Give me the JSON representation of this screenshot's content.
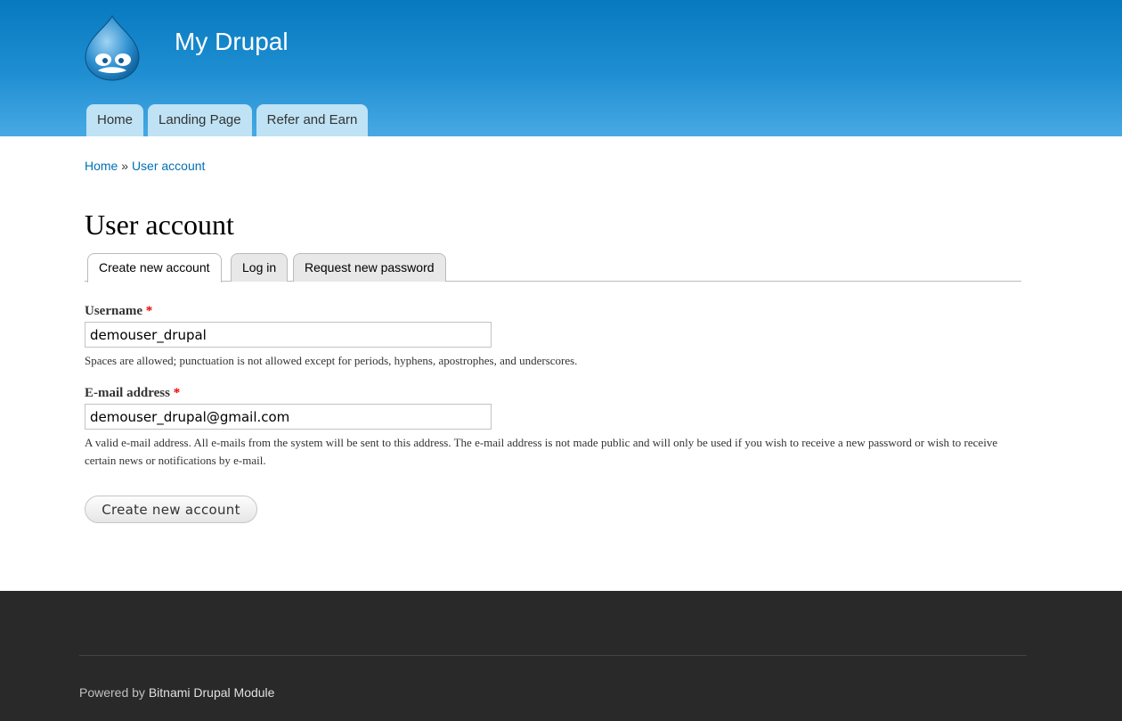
{
  "site": {
    "name": "My Drupal"
  },
  "main_menu": [
    "Home",
    "Landing Page",
    "Refer and Earn"
  ],
  "breadcrumb": {
    "home": "Home",
    "separator": "»",
    "current": "User account"
  },
  "page_title": "User account",
  "tabs": {
    "create": "Create new account",
    "login": "Log in",
    "request": "Request new password"
  },
  "form": {
    "username": {
      "label": "Username",
      "required_mark": "*",
      "value": "demouser_drupal",
      "description": "Spaces are allowed; punctuation is not allowed except for periods, hyphens, apostrophes, and underscores."
    },
    "email": {
      "label": "E-mail address",
      "required_mark": "*",
      "value": "demouser_drupal@gmail.com",
      "description": "A valid e-mail address. All e-mails from the system will be sent to this address. The e-mail address is not made public and will only be used if you wish to receive a new password or wish to receive certain news or notifications by e-mail."
    },
    "submit_label": "Create new account"
  },
  "footer": {
    "powered_by": "Powered by",
    "link": "Bitnami Drupal Module"
  },
  "colors": {
    "header_top": "#0779bf",
    "header_bottom": "#48a9e4",
    "link": "#0071b3",
    "footer_bg": "#292929",
    "required": "#ee0000"
  }
}
